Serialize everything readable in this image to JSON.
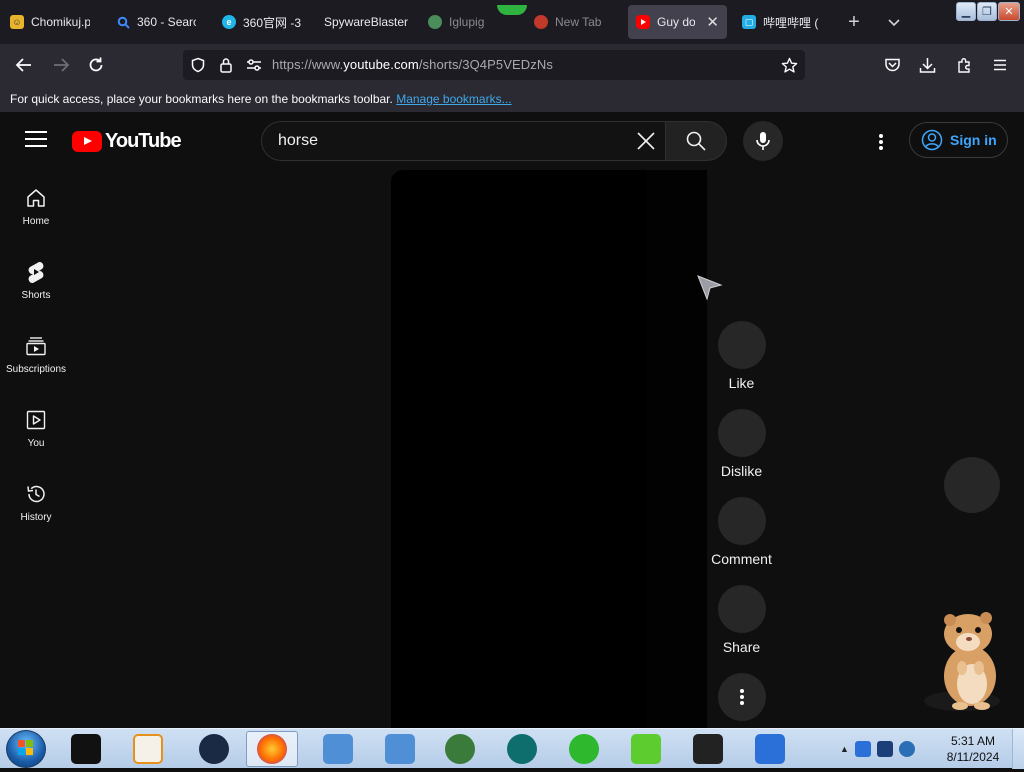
{
  "browser": {
    "tabs": [
      {
        "label": "Chomikuj.p",
        "icon": "chomikuj-icon",
        "color": "#e8b42c"
      },
      {
        "label": "360 - Searc",
        "icon": "search-icon",
        "color": "#3d8bfd"
      },
      {
        "label": "360官网 -3",
        "icon": "360-icon",
        "color": "#1fb6e8"
      },
      {
        "label": "SpywareBlaster",
        "icon": "",
        "color": ""
      },
      {
        "label": "Iglupig",
        "icon": "globe-icon",
        "color": "#4a8c5a"
      },
      {
        "label": "New Tab",
        "icon": "firefox-icon",
        "color": "#c0392b"
      },
      {
        "label": "Guy doe",
        "icon": "youtube-icon",
        "color": "#ff0000"
      },
      {
        "label": "哔哩哔哩 (",
        "icon": "bilibili-icon",
        "color": "#23ade5"
      }
    ],
    "url": {
      "pre": "https://www.",
      "host": "youtube.com",
      "post": "/shorts/3Q4P5VEDzNs"
    },
    "bookmarks_text": "For quick access, place your bookmarks here on the bookmarks toolbar.",
    "bookmarks_link": "Manage bookmarks..."
  },
  "youtube": {
    "logo_text": "YouTube",
    "search_value": "horse",
    "sign_in": "Sign in",
    "sidebar": [
      {
        "label": "Home",
        "icon": "home-icon"
      },
      {
        "label": "Shorts",
        "icon": "shorts-icon"
      },
      {
        "label": "Subscriptions",
        "icon": "subscriptions-icon"
      },
      {
        "label": "You",
        "icon": "you-icon"
      },
      {
        "label": "History",
        "icon": "history-icon"
      }
    ],
    "actions": [
      {
        "label": "Like"
      },
      {
        "label": "Dislike"
      },
      {
        "label": "Comment"
      },
      {
        "label": "Share"
      }
    ]
  },
  "taskbar": {
    "time": "5:31 AM",
    "date": "8/11/2024"
  },
  "colors": {
    "yt_bg": "#0f0f0f",
    "yt_red": "#ff0000",
    "link_blue": "#3ea6ff",
    "browser_chrome": "#2b2a33"
  }
}
